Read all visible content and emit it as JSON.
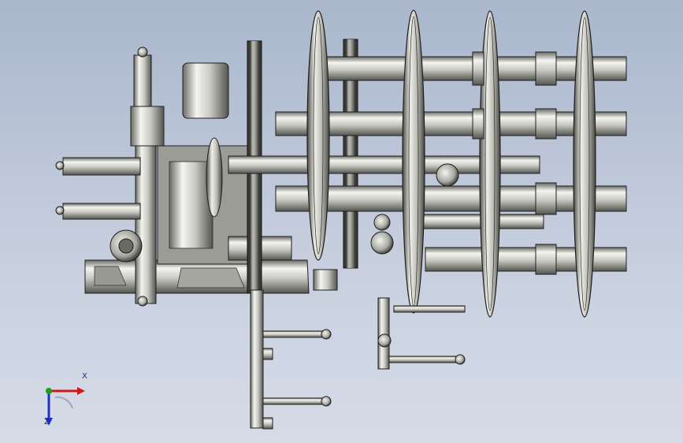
{
  "viewport": {
    "background_top": "#a9b6cc",
    "background_bottom": "#d6dce7"
  },
  "model": {
    "metal_light": "#f2f2ef",
    "metal_mid": "#b8b8b2",
    "metal_dark": "#5c5c57",
    "outline": "#1e1e1e"
  },
  "triad": {
    "x_label": "X",
    "z_label": "Z",
    "x_color": "#d01818",
    "y_color": "#18a018",
    "z_color": "#2030c0"
  }
}
